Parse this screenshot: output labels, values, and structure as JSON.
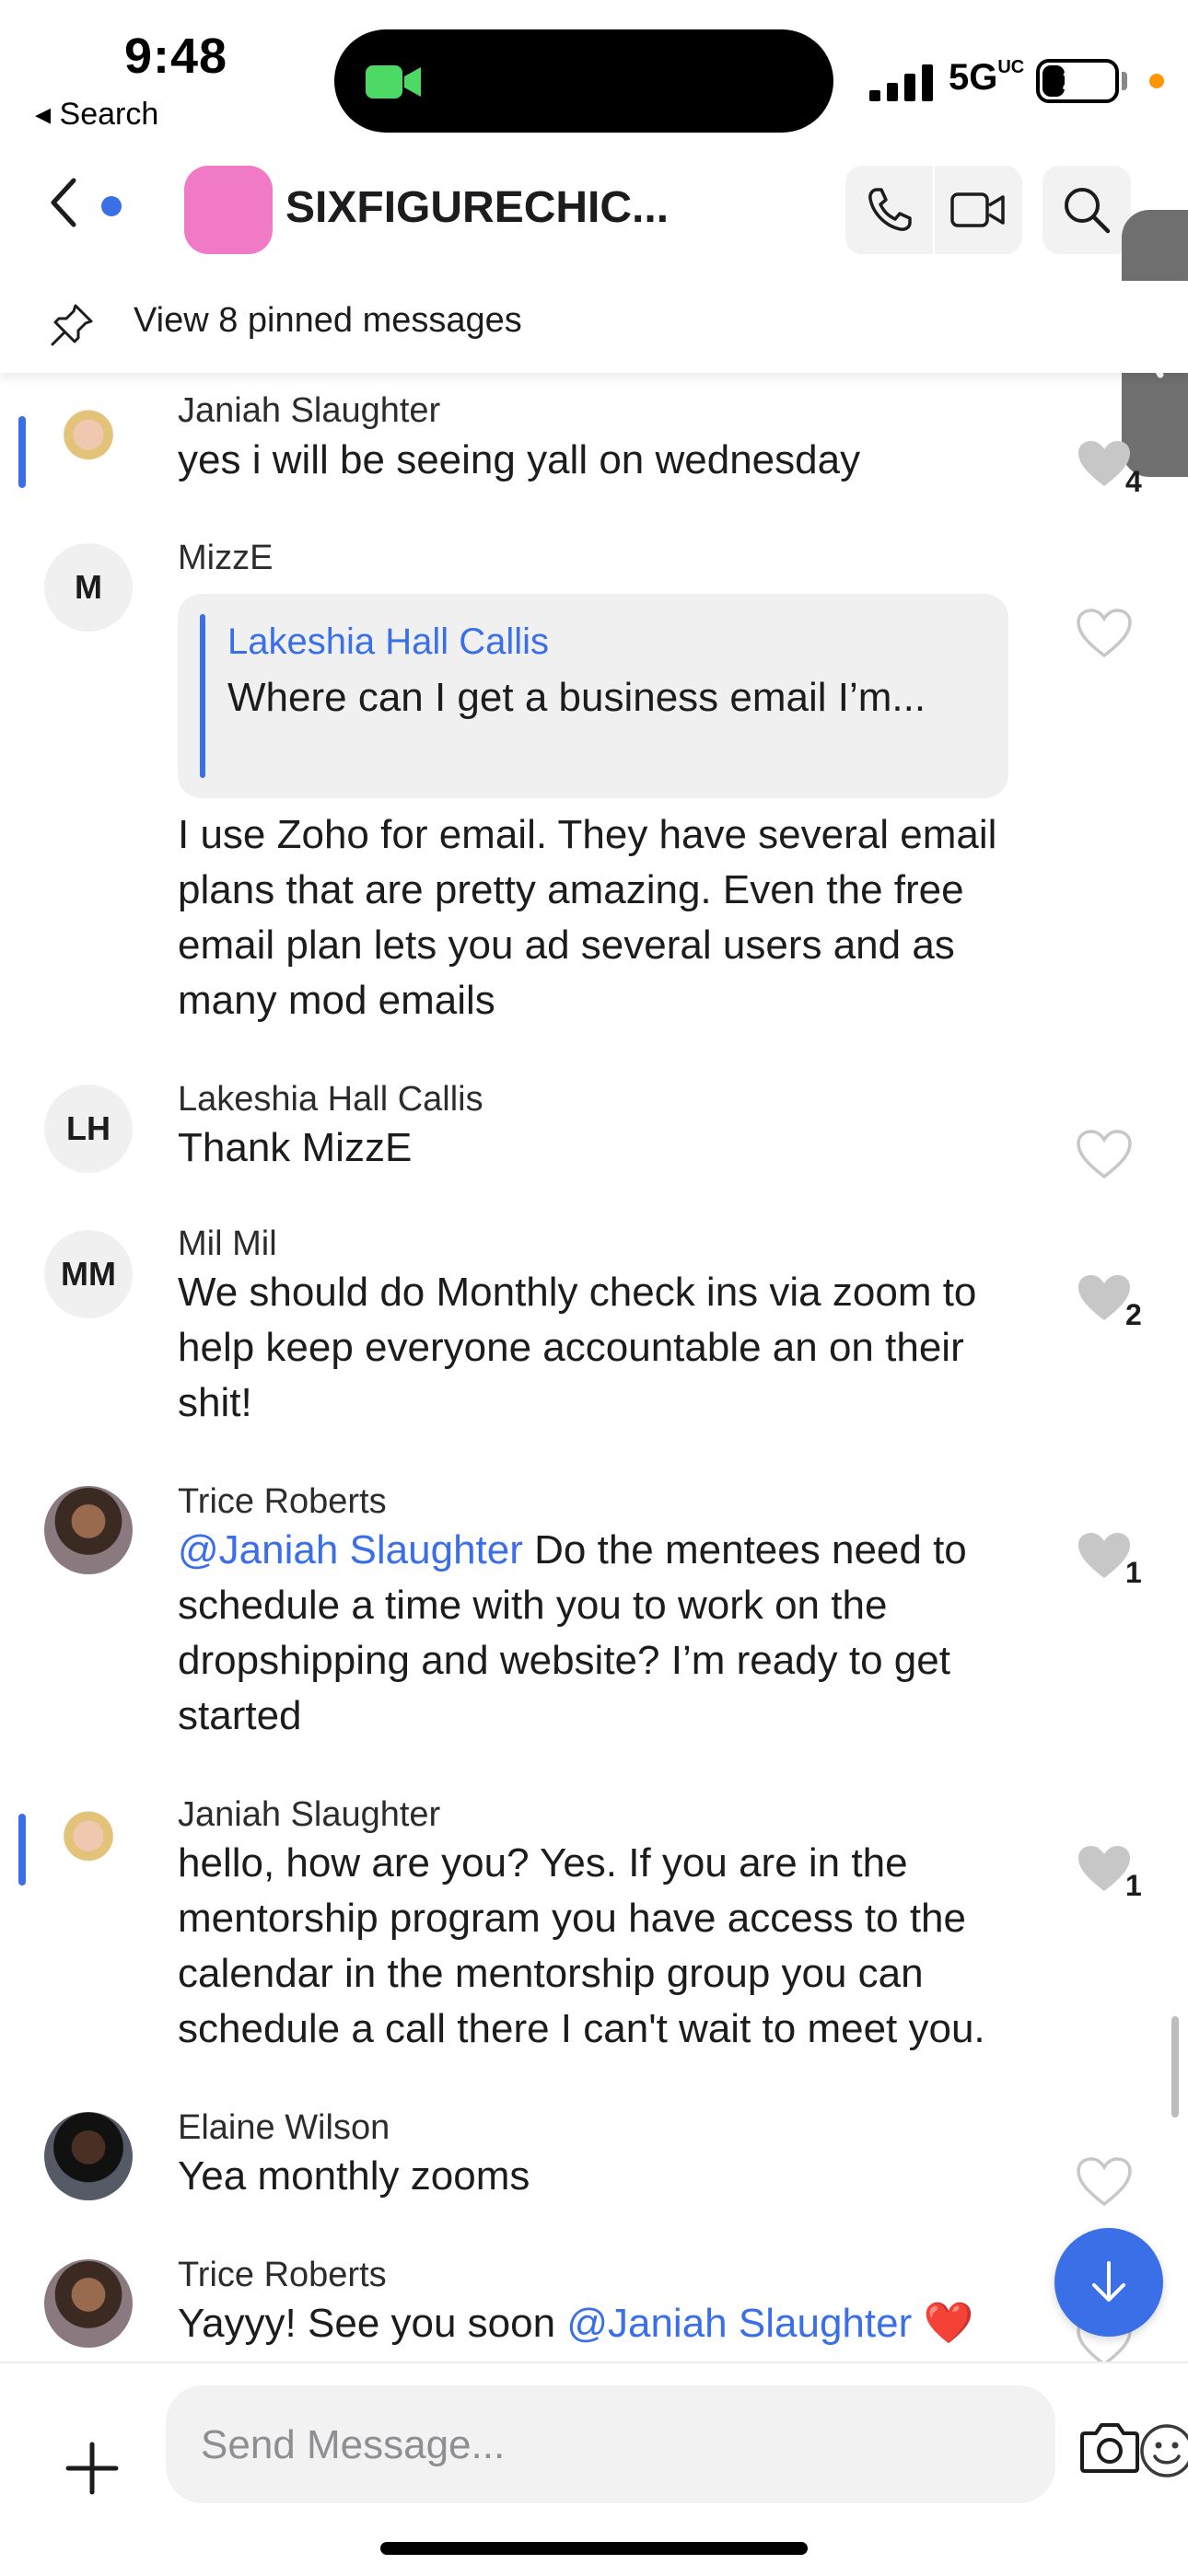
{
  "status_bar": {
    "time": "9:48",
    "back_label": "◂ Search",
    "network": "5G",
    "network_sub": "UC",
    "battery": "29"
  },
  "header": {
    "title": "SIXFIGURECHIC..."
  },
  "pinned": {
    "label": "View 8 pinned messages"
  },
  "messages": [
    {
      "sender": "Janiah Slaughter",
      "text": "yes i will be seeing yall on wednesday",
      "likes": "4"
    },
    {
      "sender": "MizzE",
      "initials": "M",
      "reply_to": {
        "name": "Lakeshia Hall Callis",
        "text": "Where can I get a business email  I’m..."
      },
      "line1": "I use Zoho for email. They have several email",
      "line2": "plans  that are pretty amazing. Even the free",
      "line3": "email plan lets you ad several users and as",
      "line4": "many mod emails"
    },
    {
      "sender": "Lakeshia Hall Callis",
      "initials": "LH",
      "text": "Thank MizzE"
    },
    {
      "sender": "Mil Mil",
      "initials": "MM",
      "line1": "We should do Monthly check ins via zoom to",
      "line2": "help keep everyone accountable an on their",
      "line3": "shit!",
      "likes": "2"
    },
    {
      "sender": "Trice Roberts",
      "mention": "@Janiah Slaughter",
      "line1_rest": " Do the mentees need to",
      "line2": "schedule a time with you to work on the",
      "line3": "dropshipping and website? I’m ready to get",
      "line4": "started",
      "likes": "1"
    },
    {
      "sender": "Janiah Slaughter",
      "line1": "hello, how are you? Yes. If you are in the",
      "line2": "mentorship program you have access to the",
      "line3": "calendar in the mentorship group you can",
      "line4": "schedule a call there I can't wait to meet you.",
      "likes": "1"
    },
    {
      "sender": "Elaine Wilson",
      "text": "Yea monthly zooms"
    },
    {
      "sender": "Trice Roberts",
      "text_before": "Yayyy! See you soon ",
      "mention": "@Janiah Slaughter",
      "emoji": "❤️"
    }
  ],
  "composer": {
    "placeholder": "Send Message..."
  },
  "colors": {
    "accent": "#3a6fe8",
    "group_avatar": "#f07ac6"
  }
}
